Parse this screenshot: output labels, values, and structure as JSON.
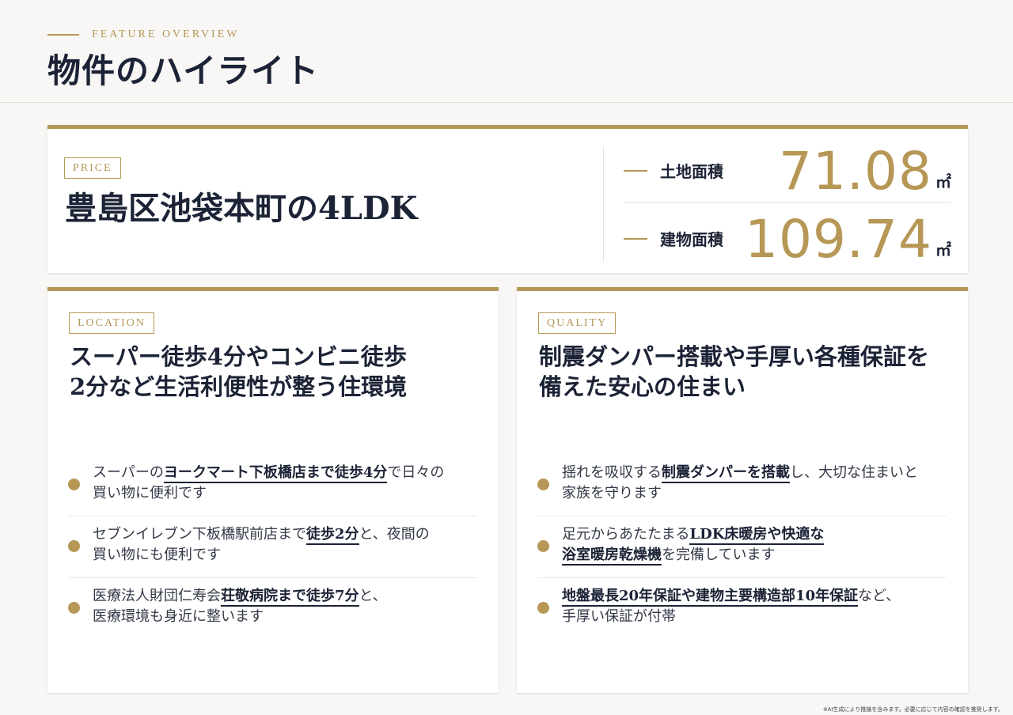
{
  "header": {
    "eyebrow": "FEATURE OVERVIEW",
    "title": "物件のハイライト"
  },
  "summary": {
    "tag": "PRICE",
    "title": "豊島区池袋本町の4LDK",
    "stats": [
      {
        "label": "土地面積",
        "value": "71.08",
        "unit": "㎡"
      },
      {
        "label": "建物面積",
        "value": "109.74",
        "unit": "㎡"
      }
    ]
  },
  "location": {
    "tag": "LOCATION",
    "title_lines": [
      "スーパー徒歩4分やコンビニ徒歩",
      "2分など生活利便性が整う住環境"
    ],
    "bullets": [
      {
        "lines": [
          [
            {
              "t": "スーパーの",
              "h": false
            },
            {
              "t": "ヨークマート下板橋店まで徒歩4分",
              "h": true
            },
            {
              "t": "で日々の",
              "h": false
            }
          ],
          [
            {
              "t": "買い物に便利です",
              "h": false
            }
          ]
        ]
      },
      {
        "lines": [
          [
            {
              "t": "セブンイレブン下板橋駅前店まで",
              "h": false
            },
            {
              "t": "徒歩2分",
              "h": true
            },
            {
              "t": "と、夜間の",
              "h": false
            }
          ],
          [
            {
              "t": "買い物にも便利です",
              "h": false
            }
          ]
        ]
      },
      {
        "lines": [
          [
            {
              "t": "医療法人財団仁寿会",
              "h": false
            },
            {
              "t": "荘敬病院まで徒歩7分",
              "h": true
            },
            {
              "t": "と、",
              "h": false
            }
          ],
          [
            {
              "t": "医療環境も身近に整います",
              "h": false
            }
          ]
        ]
      }
    ]
  },
  "quality": {
    "tag": "QUALITY",
    "title_lines": [
      "制震ダンパー搭載や手厚い各種保証を",
      "備えた安心の住まい"
    ],
    "bullets": [
      {
        "lines": [
          [
            {
              "t": "揺れを吸収する",
              "h": false
            },
            {
              "t": "制震ダンパーを搭載",
              "h": true
            },
            {
              "t": "し、大切な住まいと",
              "h": false
            }
          ],
          [
            {
              "t": "家族を守ります",
              "h": false
            }
          ]
        ]
      },
      {
        "lines": [
          [
            {
              "t": "足元からあたたまる",
              "h": false
            },
            {
              "t": "LDK床暖房や快適な",
              "h": true
            }
          ],
          [
            {
              "t": "浴室暖房乾燥機",
              "h": true
            },
            {
              "t": "を完備しています",
              "h": false
            }
          ]
        ]
      },
      {
        "lines": [
          [
            {
              "t": "地盤最長20年保証や建物主要構造部10年保証",
              "h": true
            },
            {
              "t": "など、",
              "h": false
            }
          ],
          [
            {
              "t": "手厚い保証が付帯",
              "h": false
            }
          ]
        ]
      }
    ]
  },
  "footnote": "※AI生成により推論を含みます。必要に応じて内容の確認を推奨します。",
  "colors": {
    "accent": "#b69756",
    "text": "#1c2336",
    "background": "#f8f7f5"
  }
}
